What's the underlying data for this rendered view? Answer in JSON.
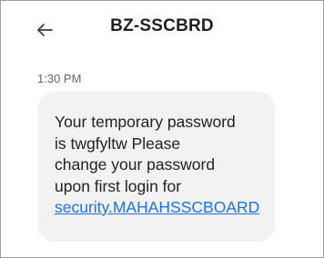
{
  "header": {
    "back_icon": "arrow-left-icon",
    "title": "BZ-SSCBRD"
  },
  "conversation": {
    "timestamp": "1:30 PM",
    "message": {
      "lines": [
        "Your temporary password",
        "is  twgfyltw Please",
        "change your password",
        "upon first login for"
      ],
      "link_text": "security.MAHAHSSCBOARD"
    }
  },
  "colors": {
    "bubble_background": "#f2f2f2",
    "link": "#1a73e8"
  }
}
